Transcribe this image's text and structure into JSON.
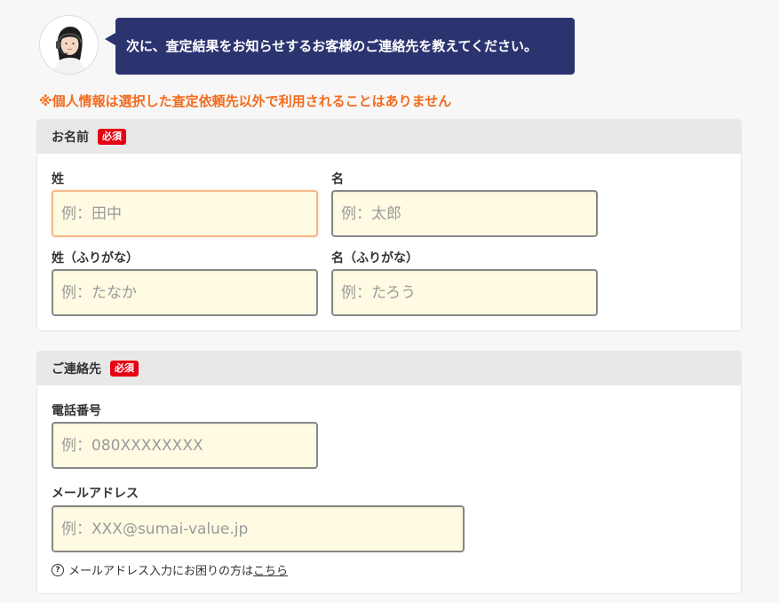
{
  "operator": {
    "avatar_icon": "operator-avatar-icon",
    "message": "次に、査定結果をお知らせするお客様のご連絡先を教えてください。"
  },
  "notice": "※個人情報は選択した査定依頼先以外で利用されることはありません",
  "name_section": {
    "title": "お名前",
    "badge": "必須",
    "last_name": {
      "label": "姓",
      "placeholder": "例：田中",
      "value": ""
    },
    "first_name": {
      "label": "名",
      "placeholder": "例：太郎",
      "value": ""
    },
    "last_name_kana": {
      "label": "姓（ふりがな）",
      "placeholder": "例：たなか",
      "value": ""
    },
    "first_name_kana": {
      "label": "名（ふりがな）",
      "placeholder": "例：たろう",
      "value": ""
    }
  },
  "contact_section": {
    "title": "ご連絡先",
    "badge": "必須",
    "phone": {
      "label": "電話番号",
      "placeholder": "例：080XXXXXXXX",
      "value": ""
    },
    "email": {
      "label": "メールアドレス",
      "placeholder": "例：XXX@sumai-value.jp",
      "value": ""
    },
    "help": {
      "icon": "question-circle-icon",
      "text": "メールアドレス入力にお困りの方は",
      "link": "こちら"
    }
  },
  "colors": {
    "bubble": "#2c3470",
    "notice": "#f26b1d",
    "badge": "#e60012",
    "input_bg": "#fffbe3",
    "header_bg": "#e8e8e8"
  }
}
